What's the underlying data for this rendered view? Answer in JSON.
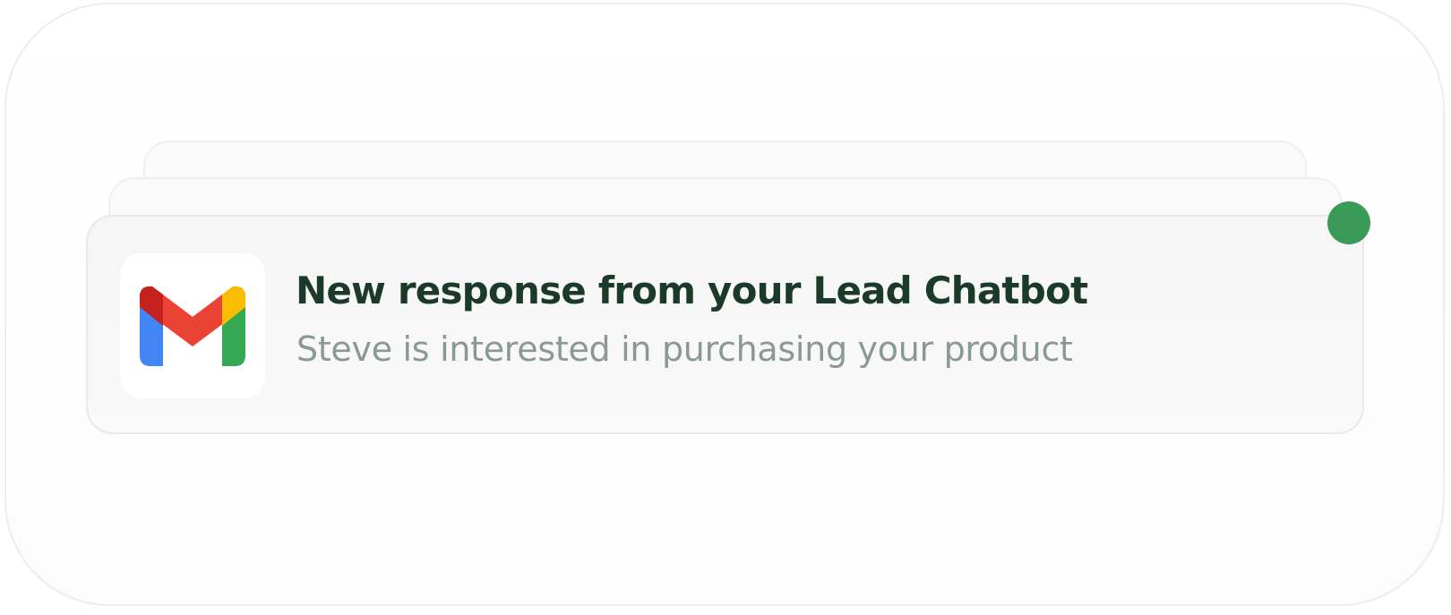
{
  "notification": {
    "app_icon": "gmail-icon",
    "title": "New response from your Lead Chatbot",
    "body": "Steve is interested in purchasing your product",
    "status": "unread"
  },
  "colors": {
    "title": "#1c3a2a",
    "body": "#8a9a92",
    "status_dot": "#3a9a58",
    "gmail_blue": "#4285f4",
    "gmail_red": "#ea4335",
    "gmail_dark_red": "#c5221f",
    "gmail_yellow": "#fbbc04",
    "gmail_green": "#34a853"
  }
}
